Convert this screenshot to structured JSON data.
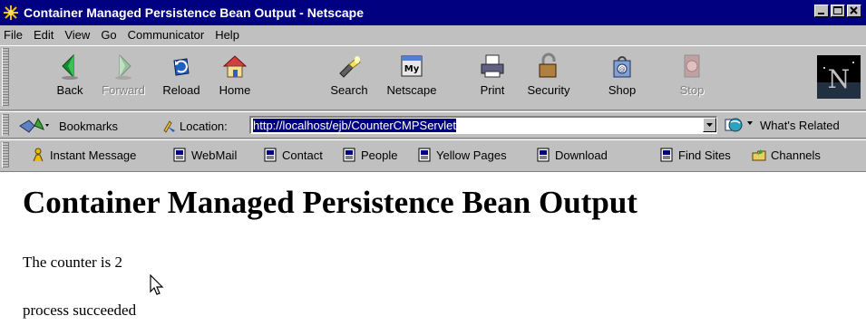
{
  "window": {
    "title": "Container Managed Persistence Bean Output - Netscape"
  },
  "menu": [
    {
      "label": "File"
    },
    {
      "label": "Edit"
    },
    {
      "label": "View"
    },
    {
      "label": "Go"
    },
    {
      "label": "Communicator"
    },
    {
      "label": "Help"
    }
  ],
  "nav_toolbar": {
    "buttons": [
      {
        "label": "Back",
        "icon": "back-arrow-icon",
        "enabled": true
      },
      {
        "label": "Forward",
        "icon": "forward-arrow-icon",
        "enabled": false
      },
      {
        "label": "Reload",
        "icon": "reload-icon",
        "enabled": true
      },
      {
        "label": "Home",
        "icon": "home-icon",
        "enabled": true
      },
      {
        "label": "Search",
        "icon": "search-flashlight-icon",
        "enabled": true
      },
      {
        "label": "Netscape",
        "icon": "my-netscape-icon",
        "enabled": true
      },
      {
        "label": "Print",
        "icon": "printer-icon",
        "enabled": true
      },
      {
        "label": "Security",
        "icon": "padlock-icon",
        "enabled": true
      },
      {
        "label": "Shop",
        "icon": "shopping-bag-icon",
        "enabled": true
      },
      {
        "label": "Stop",
        "icon": "stop-icon",
        "enabled": false
      }
    ],
    "logo_letter": "N",
    "my_badge": "My"
  },
  "location_bar": {
    "bookmarks_label": "Bookmarks",
    "location_label": "Location:",
    "url": "http://localhost/ejb/CounterCMPServlet",
    "related_label": "What's Related"
  },
  "personal_toolbar": [
    {
      "label": "Instant Message",
      "icon": "instant-message-person-icon"
    },
    {
      "label": "WebMail",
      "icon": "bookmark-page-icon"
    },
    {
      "label": "Contact",
      "icon": "bookmark-page-icon"
    },
    {
      "label": "People",
      "icon": "bookmark-page-icon"
    },
    {
      "label": "Yellow Pages",
      "icon": "bookmark-page-icon"
    },
    {
      "label": "Download",
      "icon": "bookmark-page-icon"
    },
    {
      "label": "Find Sites",
      "icon": "bookmark-page-icon"
    },
    {
      "label": "Channels",
      "icon": "channels-folder-icon"
    }
  ],
  "page": {
    "heading": "Container Managed Persistence Bean Output",
    "counter_text": "The counter is 2",
    "status_text": "process succeeded"
  },
  "colors": {
    "title_bar": "#000080",
    "chrome": "#c0c0c0",
    "url_selection": "#000080"
  }
}
